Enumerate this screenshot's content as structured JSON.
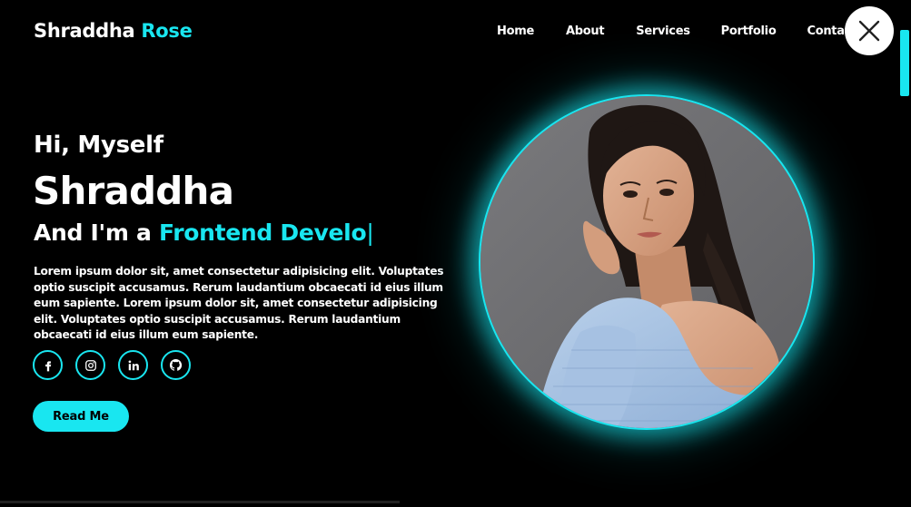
{
  "header": {
    "logo_first": "Shraddha",
    "logo_second": "Rose",
    "nav": [
      "Home",
      "About",
      "Services",
      "Portfolio",
      "Contact"
    ]
  },
  "hero": {
    "greeting": "Hi, Myself",
    "name": "Shraddha",
    "role_prefix": "And I'm a",
    "role_typed": "Frontend Develo",
    "cursor": "|",
    "paragraph": "Lorem ipsum dolor sit, amet consectetur adipisicing elit. Voluptates optio suscipit accusamus. Rerum laudantium obcaecati id eius illum eum sapiente. Lorem ipsum dolor sit, amet consectetur adipisicing elit. Voluptates optio suscipit accusamus. Rerum laudantium obcaecati id eius illum eum sapiente.",
    "button": "Read Me"
  },
  "socials": [
    {
      "icon": "facebook-icon"
    },
    {
      "icon": "instagram-icon"
    },
    {
      "icon": "linkedin-icon"
    },
    {
      "icon": "github-icon"
    }
  ],
  "colors": {
    "accent": "#19e6f0",
    "background": "#000000",
    "text": "#ffffff"
  },
  "close_icon": "close-icon"
}
